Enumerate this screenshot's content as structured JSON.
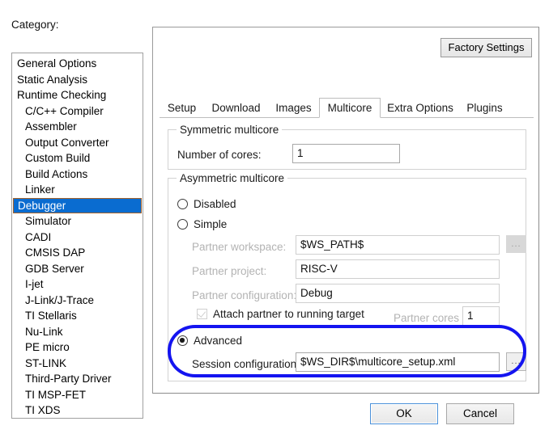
{
  "sidebar": {
    "label": "Category:",
    "items": [
      {
        "label": "General Options",
        "indent": false,
        "selected": false
      },
      {
        "label": "Static Analysis",
        "indent": false,
        "selected": false
      },
      {
        "label": "Runtime Checking",
        "indent": false,
        "selected": false
      },
      {
        "label": "C/C++ Compiler",
        "indent": true,
        "selected": false
      },
      {
        "label": "Assembler",
        "indent": true,
        "selected": false
      },
      {
        "label": "Output Converter",
        "indent": true,
        "selected": false
      },
      {
        "label": "Custom Build",
        "indent": true,
        "selected": false
      },
      {
        "label": "Build Actions",
        "indent": true,
        "selected": false
      },
      {
        "label": "Linker",
        "indent": true,
        "selected": false
      },
      {
        "label": "Debugger",
        "indent": true,
        "selected": true
      },
      {
        "label": "Simulator",
        "indent": true,
        "selected": false
      },
      {
        "label": "CADI",
        "indent": true,
        "selected": false
      },
      {
        "label": "CMSIS DAP",
        "indent": true,
        "selected": false
      },
      {
        "label": "GDB Server",
        "indent": true,
        "selected": false
      },
      {
        "label": "I-jet",
        "indent": true,
        "selected": false
      },
      {
        "label": "J-Link/J-Trace",
        "indent": true,
        "selected": false
      },
      {
        "label": "TI Stellaris",
        "indent": true,
        "selected": false
      },
      {
        "label": "Nu-Link",
        "indent": true,
        "selected": false
      },
      {
        "label": "PE micro",
        "indent": true,
        "selected": false
      },
      {
        "label": "ST-LINK",
        "indent": true,
        "selected": false
      },
      {
        "label": "Third-Party Driver",
        "indent": true,
        "selected": false
      },
      {
        "label": "TI MSP-FET",
        "indent": true,
        "selected": false
      },
      {
        "label": "TI XDS",
        "indent": true,
        "selected": false
      }
    ]
  },
  "panel": {
    "factory_settings_label": "Factory Settings",
    "tabs": [
      {
        "label": "Setup",
        "active": false
      },
      {
        "label": "Download",
        "active": false
      },
      {
        "label": "Images",
        "active": false
      },
      {
        "label": "Multicore",
        "active": true
      },
      {
        "label": "Extra Options",
        "active": false
      },
      {
        "label": "Plugins",
        "active": false
      }
    ],
    "symmetric": {
      "title": "Symmetric multicore",
      "cores_label": "Number of cores:",
      "cores_value": "1"
    },
    "asymmetric": {
      "title": "Asymmetric multicore",
      "option_disabled": "Disabled",
      "option_simple": "Simple",
      "option_advanced": "Advanced",
      "selected_option": "Advanced",
      "partner_workspace_label": "Partner workspace:",
      "partner_workspace_value": "$WS_PATH$",
      "partner_project_label": "Partner project:",
      "partner_project_value": "RISC-V",
      "partner_configuration_label": "Partner configuration:",
      "partner_configuration_value": "Debug",
      "attach_label": "Attach partner to running target",
      "partner_cores_label": "Partner cores",
      "partner_cores_value": "1",
      "session_configuration_label": "Session configuration:",
      "session_configuration_value": "$WS_DIR$\\multicore_setup.xml",
      "browse_label": "..."
    }
  },
  "footer": {
    "ok_label": "OK",
    "cancel_label": "Cancel"
  },
  "colors": {
    "selection_blue": "#0a6cd0",
    "highlight_blue": "#1414f0",
    "selection_border": "#a4622a"
  }
}
